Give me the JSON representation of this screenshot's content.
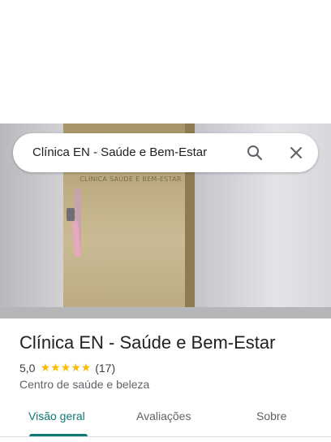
{
  "search": {
    "query": "Clínica EN - Saúde e Bem-Estar",
    "search_icon": "search-icon",
    "clear_icon": "close-icon"
  },
  "hero": {
    "door_sign": "CLÍNICA SAÚDE E BEM-ESTAR"
  },
  "place": {
    "name": "Clínica EN - Saúde e Bem-Estar",
    "rating": "5,0",
    "stars": "★★★★★",
    "review_count": "(17)",
    "category": "Centro de saúde e beleza"
  },
  "tabs": [
    {
      "label": "Visão geral",
      "active": true
    },
    {
      "label": "Avaliações",
      "active": false
    },
    {
      "label": "Sobre",
      "active": false
    }
  ],
  "colors": {
    "accent": "#0b7a75",
    "star": "#fbbc04"
  }
}
